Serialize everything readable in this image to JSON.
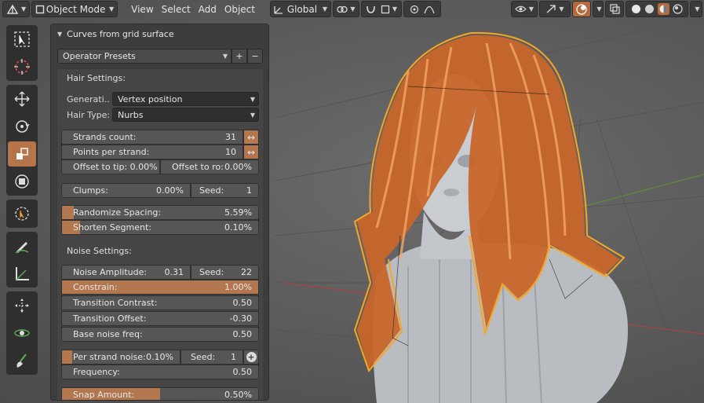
{
  "header": {
    "object_mode": "Object Mode",
    "menus": [
      "View",
      "Select",
      "Add",
      "Object"
    ],
    "orientation": "Global"
  },
  "tools": [
    "cursor-select",
    "cursor-3d",
    "move",
    "rotate",
    "scale",
    "transform",
    "annotate-select",
    "annotate",
    "measure",
    "move-view",
    "spin",
    "hair-brush"
  ],
  "panel": {
    "title": "Curves from grid surface",
    "presets": {
      "label": "Operator Presets",
      "add": "+",
      "remove": "−"
    },
    "hair_settings_label": "Hair Settings:",
    "generation": {
      "label": "Generati..",
      "value": "Vertex position"
    },
    "hair_type": {
      "label": "Hair Type:",
      "value": "Nurbs"
    },
    "strands_count": {
      "label": "Strands count:",
      "value": "31"
    },
    "points_per_strand": {
      "label": "Points per strand:",
      "value": "10"
    },
    "offset_to_tip": "Offset to tip: 0.00%",
    "offset_to_root": "Offset to ro:",
    "offset_to_root_value": "0.00%",
    "clumps": {
      "label": "Clumps:",
      "value": "0.00%"
    },
    "clumps_seed": {
      "label": "Seed:",
      "value": "1"
    },
    "randomize_spacing": {
      "label": "Randomize Spacing:",
      "value": "5.59%",
      "fill": 0.059
    },
    "shorten_segment": {
      "label": "Shorten Segment:",
      "value": "0.10%",
      "fill": 0.09
    },
    "noise_settings_label": "Noise Settings:",
    "noise_amplitude": {
      "label": "Noise Amplitude:",
      "value": "0.31"
    },
    "noise_seed": {
      "label": "Seed:",
      "value": "22"
    },
    "constrain": {
      "label": "Constrain:",
      "value": "1.00%"
    },
    "transition_contrast": {
      "label": "Transition Contrast:",
      "value": "0.50"
    },
    "transition_offset": {
      "label": "Transition Offset:",
      "value": "-0.30"
    },
    "base_noise_freq": {
      "label": "Base noise freq:",
      "value": "0.50"
    },
    "per_strand_noise": {
      "label": "Per strand noise:",
      "value": "0.10%"
    },
    "per_strand_seed": {
      "label": "Seed:",
      "value": "1"
    },
    "frequency": {
      "label": "Frequency:",
      "value": "0.50"
    },
    "snap_amount": {
      "label": "Snap Amount:",
      "value": "0.50%",
      "fill": 0.5
    }
  },
  "colors": {
    "accent": "#b2774f",
    "selection_outline": "#f5a623",
    "hair": "#c8662a",
    "viewport_bg": "#5e5e5e"
  }
}
